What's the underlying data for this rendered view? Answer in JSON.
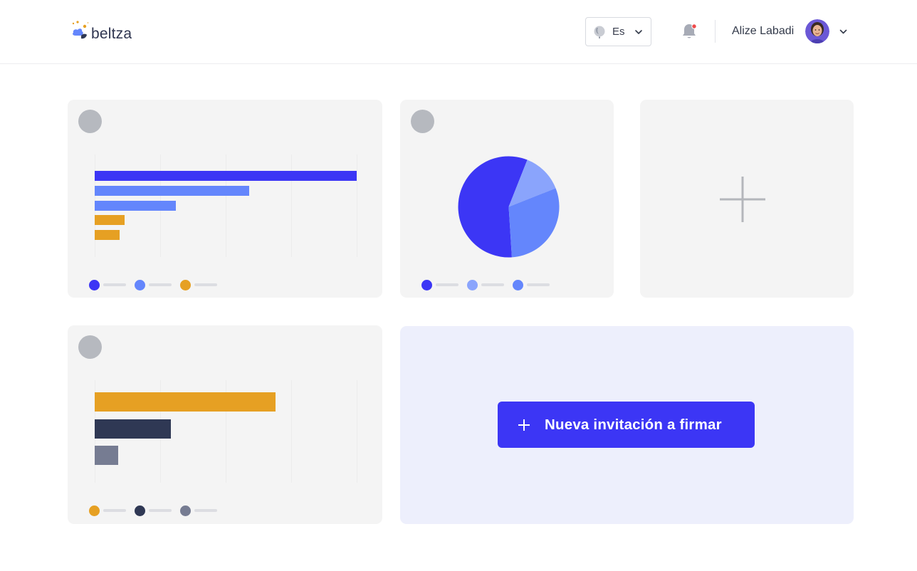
{
  "header": {
    "logo_text": "beltza",
    "language": {
      "selected": "Es",
      "icon": "globe-icon"
    },
    "notifications": {
      "icon": "bell-icon",
      "has_unread": true
    },
    "user": {
      "name": "Alize Labadi",
      "avatar_icon": "avatar"
    }
  },
  "colors": {
    "primary": "#3c36f5",
    "blue_mid": "#6486fc",
    "blue_light": "#8aa4fc",
    "orange": "#e6a023",
    "navy": "#2f3854",
    "slate": "#767c92",
    "card_bg": "#f4f4f4",
    "invite_bg": "#edeffc",
    "notification_dot": "#ef4b4b"
  },
  "chart_data": [
    {
      "type": "bar",
      "orientation": "horizontal",
      "title": "",
      "xlabel": "",
      "ylabel": "",
      "xlim": [
        0,
        100
      ],
      "grid": true,
      "values": [
        100,
        59,
        31,
        11.5,
        9.5
      ],
      "colors": [
        "#3c36f5",
        "#6486fc",
        "#6486fc",
        "#e6a023",
        "#e6a023"
      ],
      "legend_colors": [
        "#3c36f5",
        "#6486fc",
        "#e6a023"
      ]
    },
    {
      "type": "pie",
      "title": "",
      "values": [
        57,
        13,
        30
      ],
      "colors": [
        "#3c36f5",
        "#8aa4fc",
        "#6486fc"
      ],
      "legend_colors": [
        "#3c36f5",
        "#8aa4fc",
        "#6486fc"
      ]
    },
    {
      "type": "bar",
      "orientation": "horizontal",
      "title": "",
      "xlabel": "",
      "ylabel": "",
      "xlim": [
        0,
        100
      ],
      "grid": true,
      "values": [
        69,
        29,
        9
      ],
      "colors": [
        "#e6a023",
        "#2f3854",
        "#767c92"
      ],
      "legend_colors": [
        "#e6a023",
        "#2f3854",
        "#767c92"
      ]
    }
  ],
  "add_widget": {
    "icon": "plus-icon"
  },
  "invite": {
    "label": "Nueva invitación a firmar",
    "icon": "plus-icon"
  }
}
